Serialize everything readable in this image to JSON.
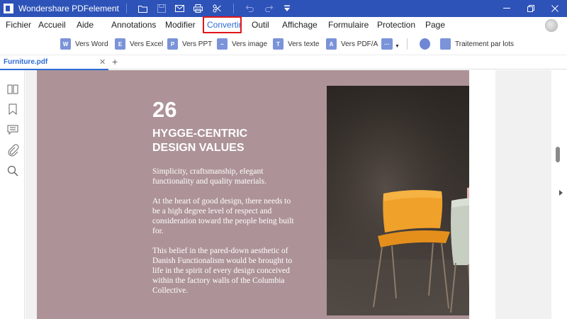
{
  "app": {
    "title": "Wondershare PDFelement"
  },
  "menu": {
    "items": [
      "Fichier",
      "Accueil",
      "Aide",
      "Annotations",
      "Modifier",
      "Convertir",
      "Outil",
      "Affichage",
      "Formulaire",
      "Protection",
      "Page"
    ],
    "active": "Convertir"
  },
  "toolbar": {
    "vers_word": "Vers Word",
    "vers_excel": "Vers Excel",
    "vers_ppt": "Vers PPT",
    "vers_image": "Vers image",
    "vers_texte": "Vers texte",
    "vers_pdfa": "Vers PDF/A",
    "batch": "Traitement par lots"
  },
  "tabs": {
    "doc_tab_label": "Furniture.pdf"
  },
  "document": {
    "number": "26",
    "heading_line1": "HYGGE-CENTRIC",
    "heading_line2": "DESIGN VALUES",
    "para1": "Simplicity, craftsmanship, elegant functionality and quality materials.",
    "para2": "At the heart of good design, there needs to be a high degree level of respect and consideration toward the people being built for.",
    "para3": "This belief in the pared-down aesthetic of Danish Functionalism would be brought to life in the spirit of every design conceived within the factory walls of the Columbia Collective."
  },
  "colors": {
    "titlebar": "#2d52b8",
    "accent": "#2d6bd6",
    "highlight_border": "#e0151b",
    "page_bg": "#ad9397",
    "chair_main": "#f0a12a",
    "chair_side": "#c7cfc2"
  },
  "icons": [
    "folder-icon",
    "save-icon",
    "mail-icon",
    "print-icon",
    "scissors-icon",
    "undo-icon",
    "redo-icon",
    "dropdown-icon",
    "minimize-icon",
    "maximize-icon",
    "close-icon",
    "thumbnails-icon",
    "bookmark-icon",
    "comment-icon",
    "attachment-icon",
    "search-icon"
  ]
}
